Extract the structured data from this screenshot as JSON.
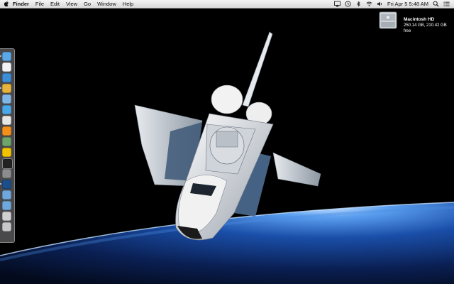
{
  "menubar": {
    "apple_glyph": "",
    "app_name": "Finder",
    "menus": [
      "File",
      "Edit",
      "View",
      "Go",
      "Window",
      "Help"
    ],
    "clock": "Fri Apr 5  5:48 AM",
    "status_icons": [
      "airplay-icon",
      "time-machine-icon",
      "bluetooth-icon",
      "wifi-icon",
      "volume-icon",
      "search-icon",
      "list-icon"
    ]
  },
  "desktop": {
    "disk": {
      "name": "Macintosh HD",
      "details": "250.14 GB, 210.42 GB free"
    }
  },
  "dock": {
    "items": [
      {
        "name": "finder-icon",
        "color": "#5aa9e6",
        "running": true
      },
      {
        "name": "calendar-icon",
        "color": "#f2f2f2",
        "running": false
      },
      {
        "name": "safari-icon",
        "color": "#3b8fd9",
        "running": false
      },
      {
        "name": "chrome-icon",
        "color": "#e8b33a",
        "running": true
      },
      {
        "name": "preview-icon",
        "color": "#7fb6e6",
        "running": false
      },
      {
        "name": "itunes-icon",
        "color": "#4aa7e8",
        "running": false
      },
      {
        "name": "grab-icon",
        "color": "#e6e6e6",
        "running": false
      },
      {
        "name": "vlc-icon",
        "color": "#f39019",
        "running": false
      },
      {
        "name": "utility-icon",
        "color": "#6da56a",
        "running": false
      },
      {
        "name": "app-icon",
        "color": "#f2c200",
        "running": false
      },
      {
        "name": "terminal-icon",
        "color": "#222222",
        "running": false
      },
      {
        "name": "system-preferences-icon",
        "color": "#8c8c8c",
        "running": false
      },
      {
        "name": "photoshop-icon",
        "color": "#1c4f8a",
        "running": true
      },
      {
        "name": "documents-folder-icon",
        "color": "#6fa8dc",
        "running": false
      },
      {
        "name": "applications-folder-icon",
        "color": "#6fa8dc",
        "running": false
      },
      {
        "name": "downloads-icon",
        "color": "#d0d0d0",
        "running": false
      },
      {
        "name": "trash-icon",
        "color": "#c8c8c8",
        "running": false
      }
    ]
  }
}
